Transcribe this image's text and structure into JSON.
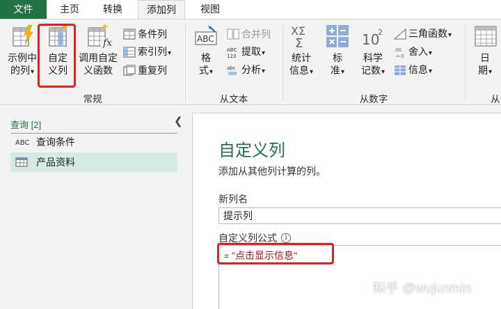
{
  "tabs": {
    "file": "文件",
    "home": "主页",
    "transform": "转换",
    "add_column": "添加列",
    "view": "视图"
  },
  "ribbon": {
    "general": {
      "label": "常规",
      "example_column": [
        "示例中",
        "的列"
      ],
      "custom_column": [
        "自定",
        "义列"
      ],
      "invoke_function": [
        "调用自定",
        "义函数"
      ],
      "conditional_column": "条件列",
      "index_column": "索引列",
      "duplicate_column": "重复列"
    },
    "from_text": {
      "label": "从文本",
      "format": [
        "格",
        "式"
      ],
      "merge_columns": "合并列",
      "extract": "提取",
      "parse": "分析"
    },
    "from_number": {
      "label": "从数字",
      "statistics": [
        "统计",
        "信息"
      ],
      "standard": [
        "标",
        "准"
      ],
      "scientific": [
        "科学",
        "记数"
      ],
      "trigonometry": "三角函数",
      "rounding": "舍入",
      "information": "信息"
    },
    "from_date": {
      "label": "从",
      "date": [
        "日",
        "期"
      ]
    }
  },
  "queries": {
    "header": "查询 [2]",
    "items": [
      {
        "label": "查询条件",
        "icon": "abc-text-icon"
      },
      {
        "label": "产品资料",
        "icon": "table-icon"
      }
    ]
  },
  "dialog": {
    "title": "自定义列",
    "description": "添加从其他列计算的列。",
    "new_column_name_label": "新列名",
    "new_column_name_value": "提示列",
    "formula_label": "自定义列公式",
    "formula_equals": "=",
    "formula_value": "\"点击显示信息\""
  },
  "watermark": "知乎 @wujunmin",
  "colors": {
    "accent": "#217346",
    "highlight": "#e02020"
  }
}
